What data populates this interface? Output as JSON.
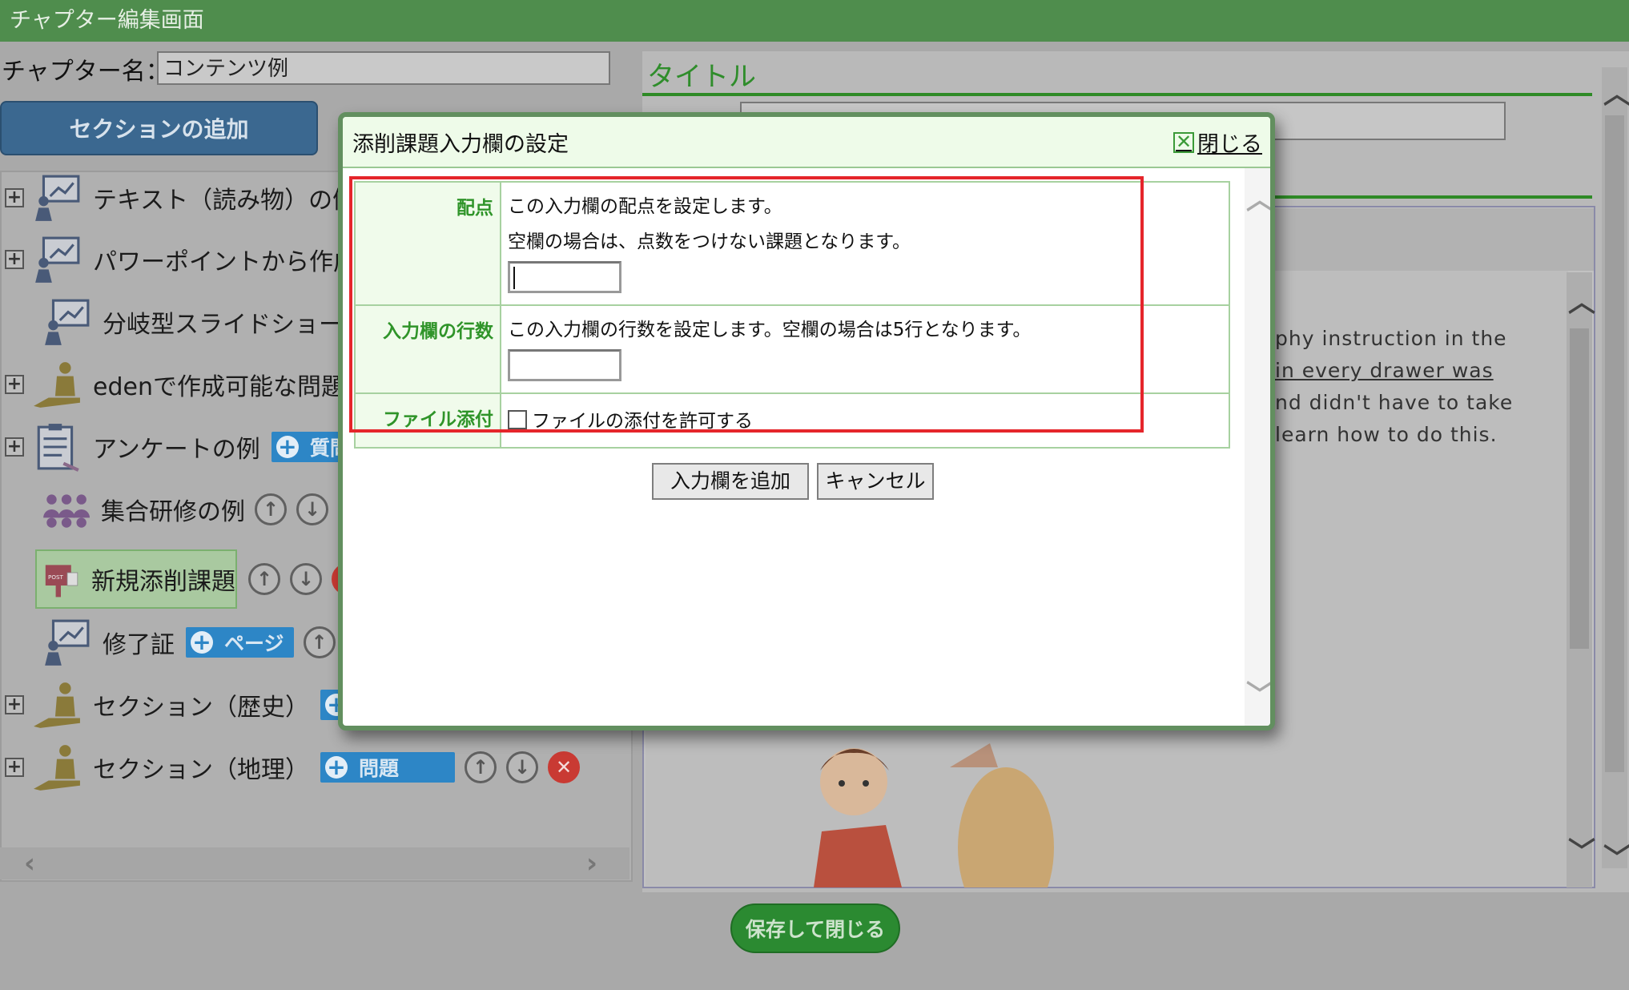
{
  "header": {
    "title": "チャプター編集画面"
  },
  "chapter": {
    "label": "チャプター名：",
    "value": "コンテンツ例"
  },
  "add_section_label": "セクションの追加",
  "tree": {
    "items": [
      {
        "label": "テキスト（読み物）の例"
      },
      {
        "label": "パワーポイントから作成"
      },
      {
        "label": "分岐型スライドショー"
      },
      {
        "label": "edenで作成可能な問題例"
      },
      {
        "label": "アンケートの例",
        "badge": "質問"
      },
      {
        "label": "集合研修の例"
      },
      {
        "label": "新規添削課題"
      },
      {
        "label": "修了証",
        "badge": "ページ"
      },
      {
        "label": "セクション（歴史）"
      },
      {
        "label": "セクション（地理）",
        "badge": "問題"
      }
    ]
  },
  "right": {
    "title_label": "タイトル",
    "editor_lines": [
      "phy instruction in the",
      "in every drawer was",
      "nd didn't have to take",
      "learn how to do this."
    ]
  },
  "save_label": "保存して閉じる",
  "modal": {
    "title": "添削課題入力欄の設定",
    "close_label": "閉じる",
    "rows": {
      "score": {
        "label": "配点",
        "desc1": "この入力欄の配点を設定します。",
        "desc2": "空欄の場合は、点数をつけない課題となります。"
      },
      "lines": {
        "label": "入力欄の行数",
        "desc": "この入力欄の行数を設定します。空欄の場合は5行となります。"
      },
      "file": {
        "label": "ファイル添付",
        "checkbox_label": "ファイルの添付を許可する"
      }
    },
    "add_button": "入力欄を追加",
    "cancel_button": "キャンセル"
  },
  "colors": {
    "header": "#4f8d4d",
    "accent_green": "#2f9429",
    "highlight_red": "#e5252b",
    "badge_blue": "#2d86c6"
  }
}
